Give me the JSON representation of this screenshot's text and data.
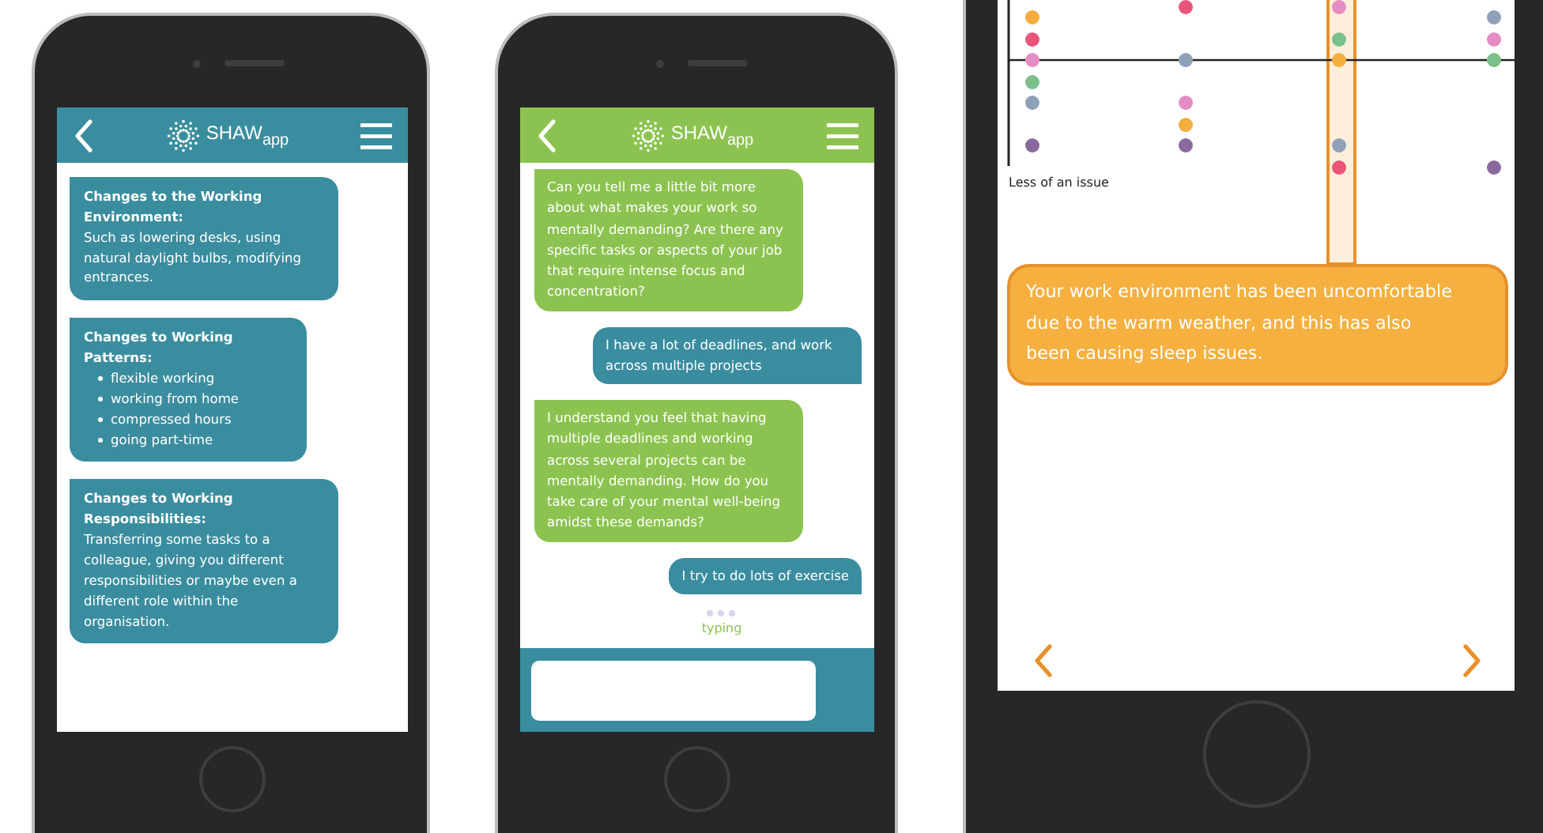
{
  "phones": [
    {
      "kind": "info",
      "logo": "SHAW$_{app}$",
      "cards": [
        {
          "title": "Changes to the Working Environment:",
          "body": "Such as lowering desks, using natural daylight bulbs, modifying entrances."
        },
        {
          "title": "Changes to Working Patterns:",
          "bullets": [
            "flexible working",
            "working from home",
            "compressed hours",
            "going part-time"
          ]
        },
        {
          "title": "Changes to Working Responsibilities:",
          "body": "Transferring some tasks to a colleague, giving you different responsibilities or maybe even a different role within the organisation."
        }
      ]
    },
    {
      "kind": "chat",
      "logo": "SHAW$_{app}$",
      "messages": [
        {
          "kind": "bot",
          "text": "Can you tell me a little bit more about what makes your work so mentally demanding? Are there any specific tasks or aspects of your job that require intense focus and concentration?"
        },
        {
          "kind": "user",
          "text": "I have a lot of deadlines, and work across multiple projects"
        },
        {
          "kind": "bot",
          "text": "I understand you feel that having multiple deadlines and working across several projects can be mentally demanding. How do you take care of your mental well-being amidst these demands?"
        },
        {
          "kind": "user",
          "text": "I try to do lots of exercise"
        }
      ],
      "typing": "typing"
    },
    {
      "kind": "chart",
      "axis_label": "Less of an issue",
      "callout": "Your work environment has been uncomfortable due to the warm weather, and this has also been causing sleep issues."
    }
  ]
}
